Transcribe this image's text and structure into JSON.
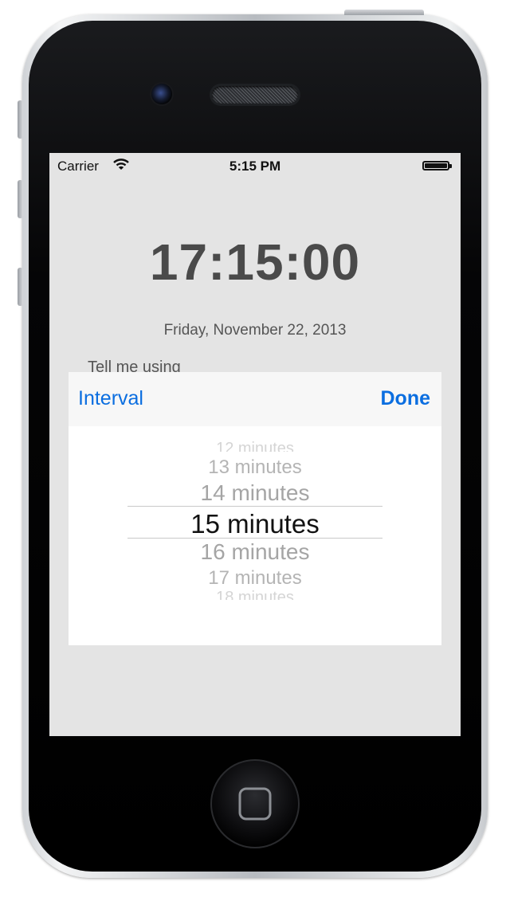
{
  "status_bar": {
    "carrier": "Carrier",
    "time": "5:15 PM",
    "wifi_icon": "wifi-icon",
    "battery_icon": "battery-icon"
  },
  "main": {
    "clock": "17:15:00",
    "date": "Friday, November 22, 2013",
    "tell_me_label": "Tell me using"
  },
  "toolbar": {
    "title": "Interval",
    "done_label": "Done"
  },
  "picker": {
    "selected": "15 minutes",
    "rows": [
      "12 minutes",
      "13 minutes",
      "14 minutes",
      "15 minutes",
      "16 minutes",
      "17 minutes",
      "18 minutes"
    ]
  },
  "colors": {
    "accent": "#0b6ee0",
    "screen_background": "#e4e4e4",
    "clock_text": "#4a4a4a"
  }
}
